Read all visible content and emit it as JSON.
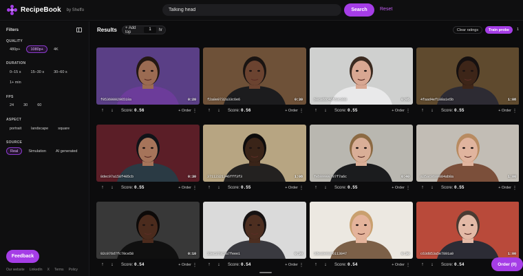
{
  "app": {
    "brand": "RecipeBook",
    "by": "by Sheffo"
  },
  "search": {
    "value": "Talking head",
    "button": "Search",
    "reset": "Reset"
  },
  "sidebar": {
    "title": "Filters",
    "quality": {
      "label": "QUALITY",
      "options": [
        "480p+",
        "1080p+",
        "4K"
      ],
      "selected": "1080p+"
    },
    "duration": {
      "label": "DURATION",
      "options": [
        "0–15 s",
        "15–30 s",
        "30–60 s",
        "1+ min"
      ]
    },
    "fps": {
      "label": "FPS",
      "options": [
        "24",
        "30",
        "60"
      ]
    },
    "aspect": {
      "label": "ASPECT",
      "options": [
        "portrait",
        "landscape",
        "square"
      ]
    },
    "source": {
      "label": "SOURCE",
      "options": [
        "Real",
        "Simulation",
        "AI generated"
      ],
      "selected": "Real"
    },
    "feedback": "Feedback",
    "footer": [
      "Our website",
      "LinkedIn",
      "X",
      "Terms",
      "Policy"
    ]
  },
  "results": {
    "title": "Results",
    "add_top_label": "+ Add top",
    "add_top_value": "1",
    "add_top_unit": "hr",
    "clear": "Clear ratings",
    "train": "Train probe",
    "count": "1"
  },
  "cards": [
    {
      "id": "f0536080296518a",
      "duration": "0:20",
      "score": "0.56",
      "bg": "#5a3f86",
      "skin": "#9b6b52",
      "hair": "#241813",
      "shirt": "#6c3c9a"
    },
    {
      "id": "f2a8e0732a33c6e6",
      "duration": "0:30",
      "score": "0.56",
      "bg": "#6e5138",
      "skin": "#6b4330",
      "hair": "#1a1412",
      "shirt": "#1c1c1e"
    },
    {
      "id": "b8caddc46f63c888",
      "duration": "0:05",
      "score": "0.55",
      "bg": "#cfd0cf",
      "skin": "#d8a792",
      "hair": "#3b2a20",
      "shirt": "#e9e9ea"
    },
    {
      "id": "4faad4ef188a1e5b",
      "duration": "1:08",
      "score": "0.55",
      "bg": "#5f4a2e",
      "skin": "#3d2518",
      "hair": "#151010",
      "shirt": "#2d2b33"
    },
    {
      "id": "8dec97a158f405cb",
      "duration": "0:30",
      "score": "0.55",
      "bg": "#5b1e27",
      "skin": "#a6745a",
      "hair": "#101318",
      "shirt": "#2a3a44"
    },
    {
      "id": "37112321346fff3f3",
      "duration": "1:08",
      "score": "0.55",
      "bg": "#b7a582",
      "skin": "#3a2418",
      "hair": "#0e0c0c",
      "shirt": "#232120"
    },
    {
      "id": "feb09900787f7a6c",
      "duration": "0:40",
      "score": "0.55",
      "bg": "#b9b7b0",
      "skin": "#d9ae97",
      "hair": "#8c6a43",
      "shirt": "#1b1c1e"
    },
    {
      "id": "a35ac8680884ab8a",
      "duration": "1:00",
      "score": "0.55",
      "bg": "#c2bdb5",
      "skin": "#e0b49e",
      "hair": "#b88b61",
      "shirt": "#7b4f3a"
    },
    {
      "id": "92c076d7fc70ce58",
      "duration": "0:10",
      "score": "0.54",
      "bg": "#383838",
      "skin": "#4b2b1d",
      "hair": "#0d0a09",
      "shirt": "#101010"
    },
    {
      "id": "33ec378c3a7feee1",
      "duration": "0:30",
      "score": "0.54",
      "bg": "#dadada",
      "skin": "#4d2e20",
      "hair": "#161212",
      "shirt": "#3a3a40"
    },
    {
      "id": "3dea8e0a96113047",
      "duration": "0:30",
      "score": "0.54",
      "bg": "#ece8e1",
      "skin": "#e4b39b",
      "hair": "#c9a06f",
      "shirt": "#7c6048"
    },
    {
      "id": "c63d853a5e7891a0",
      "duration": "1:00",
      "score": "0.54",
      "bg": "#b94a3a",
      "skin": "#e3b9a6",
      "hair": "#4a3a32",
      "shirt": "#2c2c35"
    }
  ],
  "labels": {
    "score": "Score:",
    "order": "+ Order"
  },
  "order_button": "Order (0)"
}
